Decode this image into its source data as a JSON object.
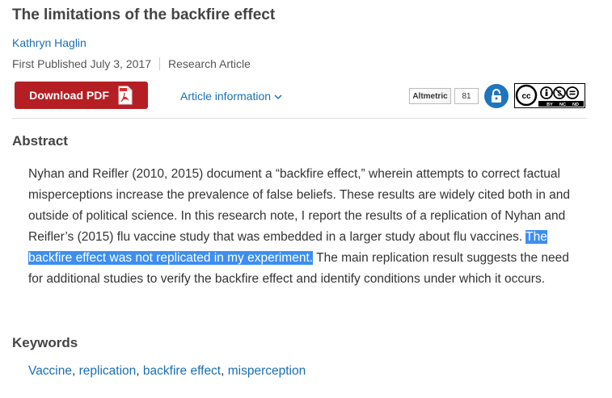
{
  "article": {
    "title": "The limitations of the backfire effect",
    "author": "Kathryn Haglin",
    "published": "First Published July 3, 2017",
    "type": "Research Article"
  },
  "toolbar": {
    "download_label": "Download PDF",
    "article_info_label": "Article information",
    "altmetric_label": "Altmetric",
    "altmetric_score": "81",
    "license_labels": [
      "BY",
      "NC",
      "ND"
    ]
  },
  "abstract": {
    "heading": "Abstract",
    "text_before": "Nyhan and Reifler (2010, 2015) document a “backfire effect,” wherein attempts to correct factual misperceptions increase the prevalence of false beliefs. These results are widely cited both in and outside of political science. In this research note, I report the results of a replication of Nyhan and Reifler’s (2015) flu vaccine study that was embedded in a larger study about flu vaccines. ",
    "text_highlighted": "The backfire effect was not replicated in my experiment.",
    "text_after": " The main replication result suggests the need for additional studies to verify the backfire effect and identify conditions under which it occurs."
  },
  "keywords": {
    "heading": "Keywords",
    "items": [
      "Vaccine",
      "replication",
      "backfire effect",
      "misperception"
    ],
    "separator": ", "
  },
  "colors": {
    "download_button": "#b51f24",
    "link": "#1a6fb5",
    "selection": "#3d8ef0",
    "lock_badge": "#1f75bd"
  }
}
